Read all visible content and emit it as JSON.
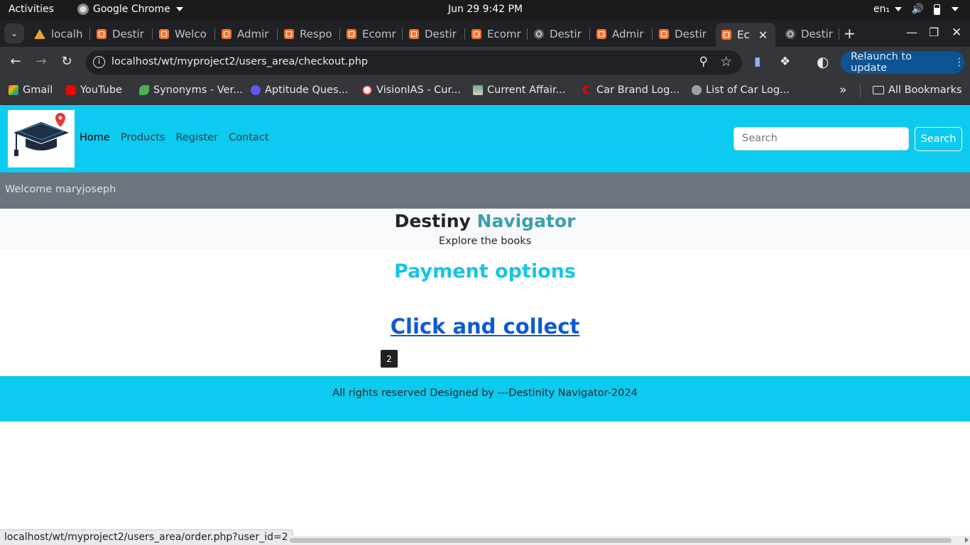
{
  "system": {
    "activities": "Activities",
    "app_name": "Google Chrome",
    "clock": "Jun 29   9:42 PM",
    "lang": "en₁"
  },
  "tabs": [
    {
      "label": "localh",
      "icon": "xampp-triangle-icon"
    },
    {
      "label": "Destir",
      "icon": "xampp-icon"
    },
    {
      "label": "Welco",
      "icon": "xampp-icon"
    },
    {
      "label": "Admir",
      "icon": "xampp-icon"
    },
    {
      "label": "Respo",
      "icon": "xampp-icon"
    },
    {
      "label": "Ecomr",
      "icon": "xampp-icon"
    },
    {
      "label": "Destir",
      "icon": "xampp-icon"
    },
    {
      "label": "Ecomr",
      "icon": "xampp-icon"
    },
    {
      "label": "Destir",
      "icon": "globe-icon"
    },
    {
      "label": "Admir",
      "icon": "xampp-icon"
    },
    {
      "label": "Destir",
      "icon": "xampp-icon"
    },
    {
      "label": "Ec",
      "icon": "xampp-icon",
      "active": true
    },
    {
      "label": "Destir",
      "icon": "globe-icon"
    }
  ],
  "toolbar": {
    "url": "localhost/wt/myproject2/users_area/checkout.php",
    "relaunch_label": "Relaunch to update"
  },
  "bookmarks": [
    {
      "label": "Gmail",
      "color": "#ea4335"
    },
    {
      "label": "YouTube",
      "color": "#ff0000"
    },
    {
      "label": "Synonyms - Ver...",
      "color": "#4caf50"
    },
    {
      "label": "Aptitude Ques...",
      "color": "#5b5bf0"
    },
    {
      "label": "VisionIAS - Cur...",
      "color": "#d33"
    },
    {
      "label": "Current Affair...",
      "color": "#6a9"
    },
    {
      "label": "Car Brand Log...",
      "color": "#e00"
    },
    {
      "label": "List of Car Log...",
      "color": "#9aa0a6"
    }
  ],
  "bookmarks_all": "All Bookmarks",
  "site": {
    "nav_links": [
      "Home",
      "Products",
      "Register",
      "Contact"
    ],
    "search_placeholder": "Search",
    "search_button": "Search",
    "welcome": "Welcome maryjoseph",
    "brand_first": "Destiny",
    "brand_second": "Navigator",
    "tagline": "Explore the books",
    "payment_title": "Payment options",
    "collect_link": "Click and collect",
    "tooltip": "2",
    "footer": "All rights reserved Designed by ---Destinity Navigator-2024",
    "accent": "#0dcaf0"
  },
  "status_url": "localhost/wt/myproject2/users_area/order.php?user_id=2"
}
